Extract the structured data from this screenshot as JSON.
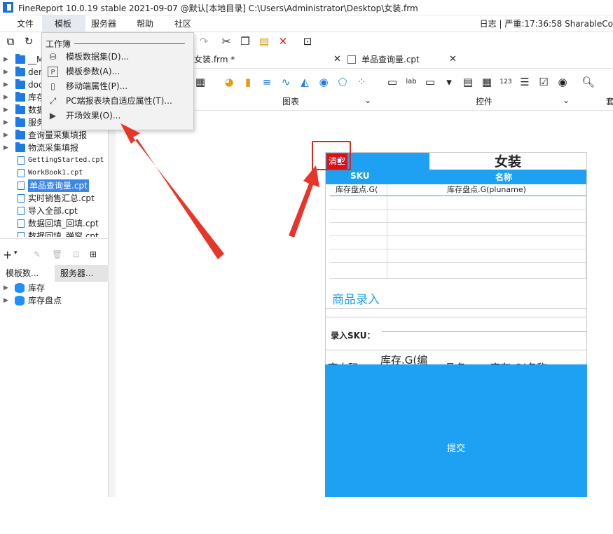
{
  "titlebar": {
    "title": "FineReport 10.0.19 stable 2021-09-07 @默认[本地目录]    C:\\Users\\Administrator\\Desktop\\女装.frm"
  },
  "menubar": {
    "items": [
      "文件",
      "模板",
      "服务器",
      "帮助",
      "社区"
    ],
    "right_info": "日志 | 严重:17:36:58 SharableCo"
  },
  "dropdown": {
    "section": "工作簿",
    "items": [
      {
        "label": "模板数据集(D)...",
        "icon": "database-icon"
      },
      {
        "label": "模板参数(A)...",
        "icon": "parameter-icon"
      },
      {
        "label": "移动端属性(P)...",
        "icon": "mobile-icon"
      },
      {
        "label": "PC端报表块自适应属性(T)...",
        "icon": "adaptive-icon"
      },
      {
        "label": "开场效果(O)...",
        "icon": "play-icon"
      }
    ]
  },
  "tree": {
    "items": [
      {
        "label": "__M",
        "type": "folder"
      },
      {
        "label": "dem",
        "type": "folder"
      },
      {
        "label": "doc",
        "type": "folder"
      },
      {
        "label": "库存",
        "type": "folder"
      },
      {
        "label": "数据",
        "type": "folder"
      },
      {
        "label": "服务",
        "type": "folder"
      },
      {
        "label": "查询量采集填报",
        "type": "folder"
      },
      {
        "label": "物流采集填报",
        "type": "folder"
      },
      {
        "label": "GettingStarted.cpt",
        "type": "file"
      },
      {
        "label": "WorkBook1.cpt",
        "type": "file"
      },
      {
        "label": "单品查询量.cpt",
        "type": "file",
        "selected": true
      },
      {
        "label": "实时销售汇总.cpt",
        "type": "file"
      },
      {
        "label": "导入全部.cpt",
        "type": "file"
      },
      {
        "label": "数据回填_回填.cpt",
        "type": "file"
      },
      {
        "label": "数据回填_弹窗.cpt",
        "type": "file"
      }
    ]
  },
  "lefttabs": [
    "模板数...",
    "服务器..."
  ],
  "datasets": [
    "库存",
    "库存盘点"
  ],
  "doctabs": [
    {
      "label": "女装.frm *"
    },
    {
      "label": "单品查询量.cpt"
    }
  ],
  "ribbon": {
    "chart_label": "图表",
    "control_label": "控件",
    "extra_label": "套"
  },
  "form": {
    "clear_button": "清空",
    "title": "女装",
    "header_sku": "SKU",
    "header_name": "名称",
    "cell_sku_value": "库存盘点.G(",
    "cell_name_value": "库存盘点.G(pluname)",
    "section_title": "商品录入",
    "input_label": "录入SKU：",
    "bottom_col1": "库内码",
    "bottom_col2": "库存.G(编",
    "bottom_col3": "品名",
    "bottom_col4": "库存.G(名称",
    "submit_button": "提交"
  },
  "colors": {
    "accent": "#1ea1f2",
    "clear_red": "#e01010",
    "annotation_red": "#e0231b"
  }
}
